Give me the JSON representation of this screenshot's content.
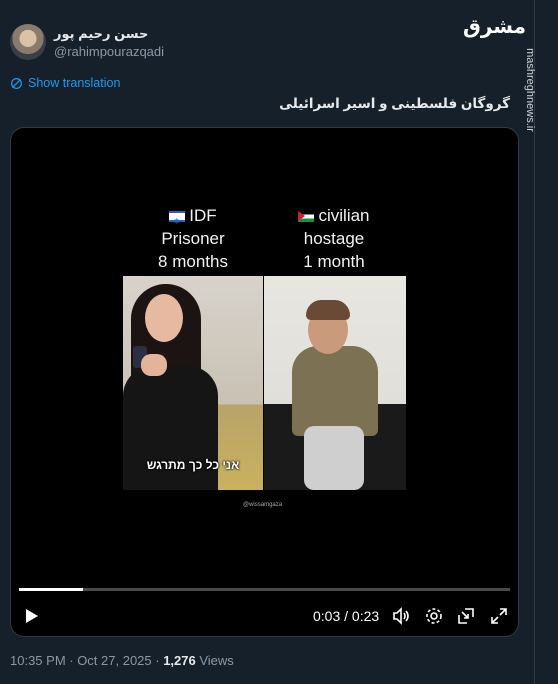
{
  "author": {
    "name": "حسن رحیم پور",
    "handle": "@rahimpourazqadi"
  },
  "translate_label": "Show translation",
  "tweet_text": "گروگان فلسطینی و اسیر اسرائیلی",
  "video": {
    "left_caption": {
      "line1": "IDF",
      "line2": "Prisoner",
      "line3": "8 months"
    },
    "right_caption": {
      "line1": "civilian",
      "line2": "hostage",
      "line3": "1 month"
    },
    "subtitle": "אני כל כך מתרגש",
    "credit": "@wissamgaza",
    "time": "0:03 / 0:23",
    "progress": 0.13
  },
  "meta": {
    "time": "10:35 PM · Oct 27, 2025 · ",
    "views_count": "1,276",
    "views_label": " Views"
  },
  "watermark": {
    "logo": "مشرق",
    "site": "mashreghnews.ir"
  }
}
